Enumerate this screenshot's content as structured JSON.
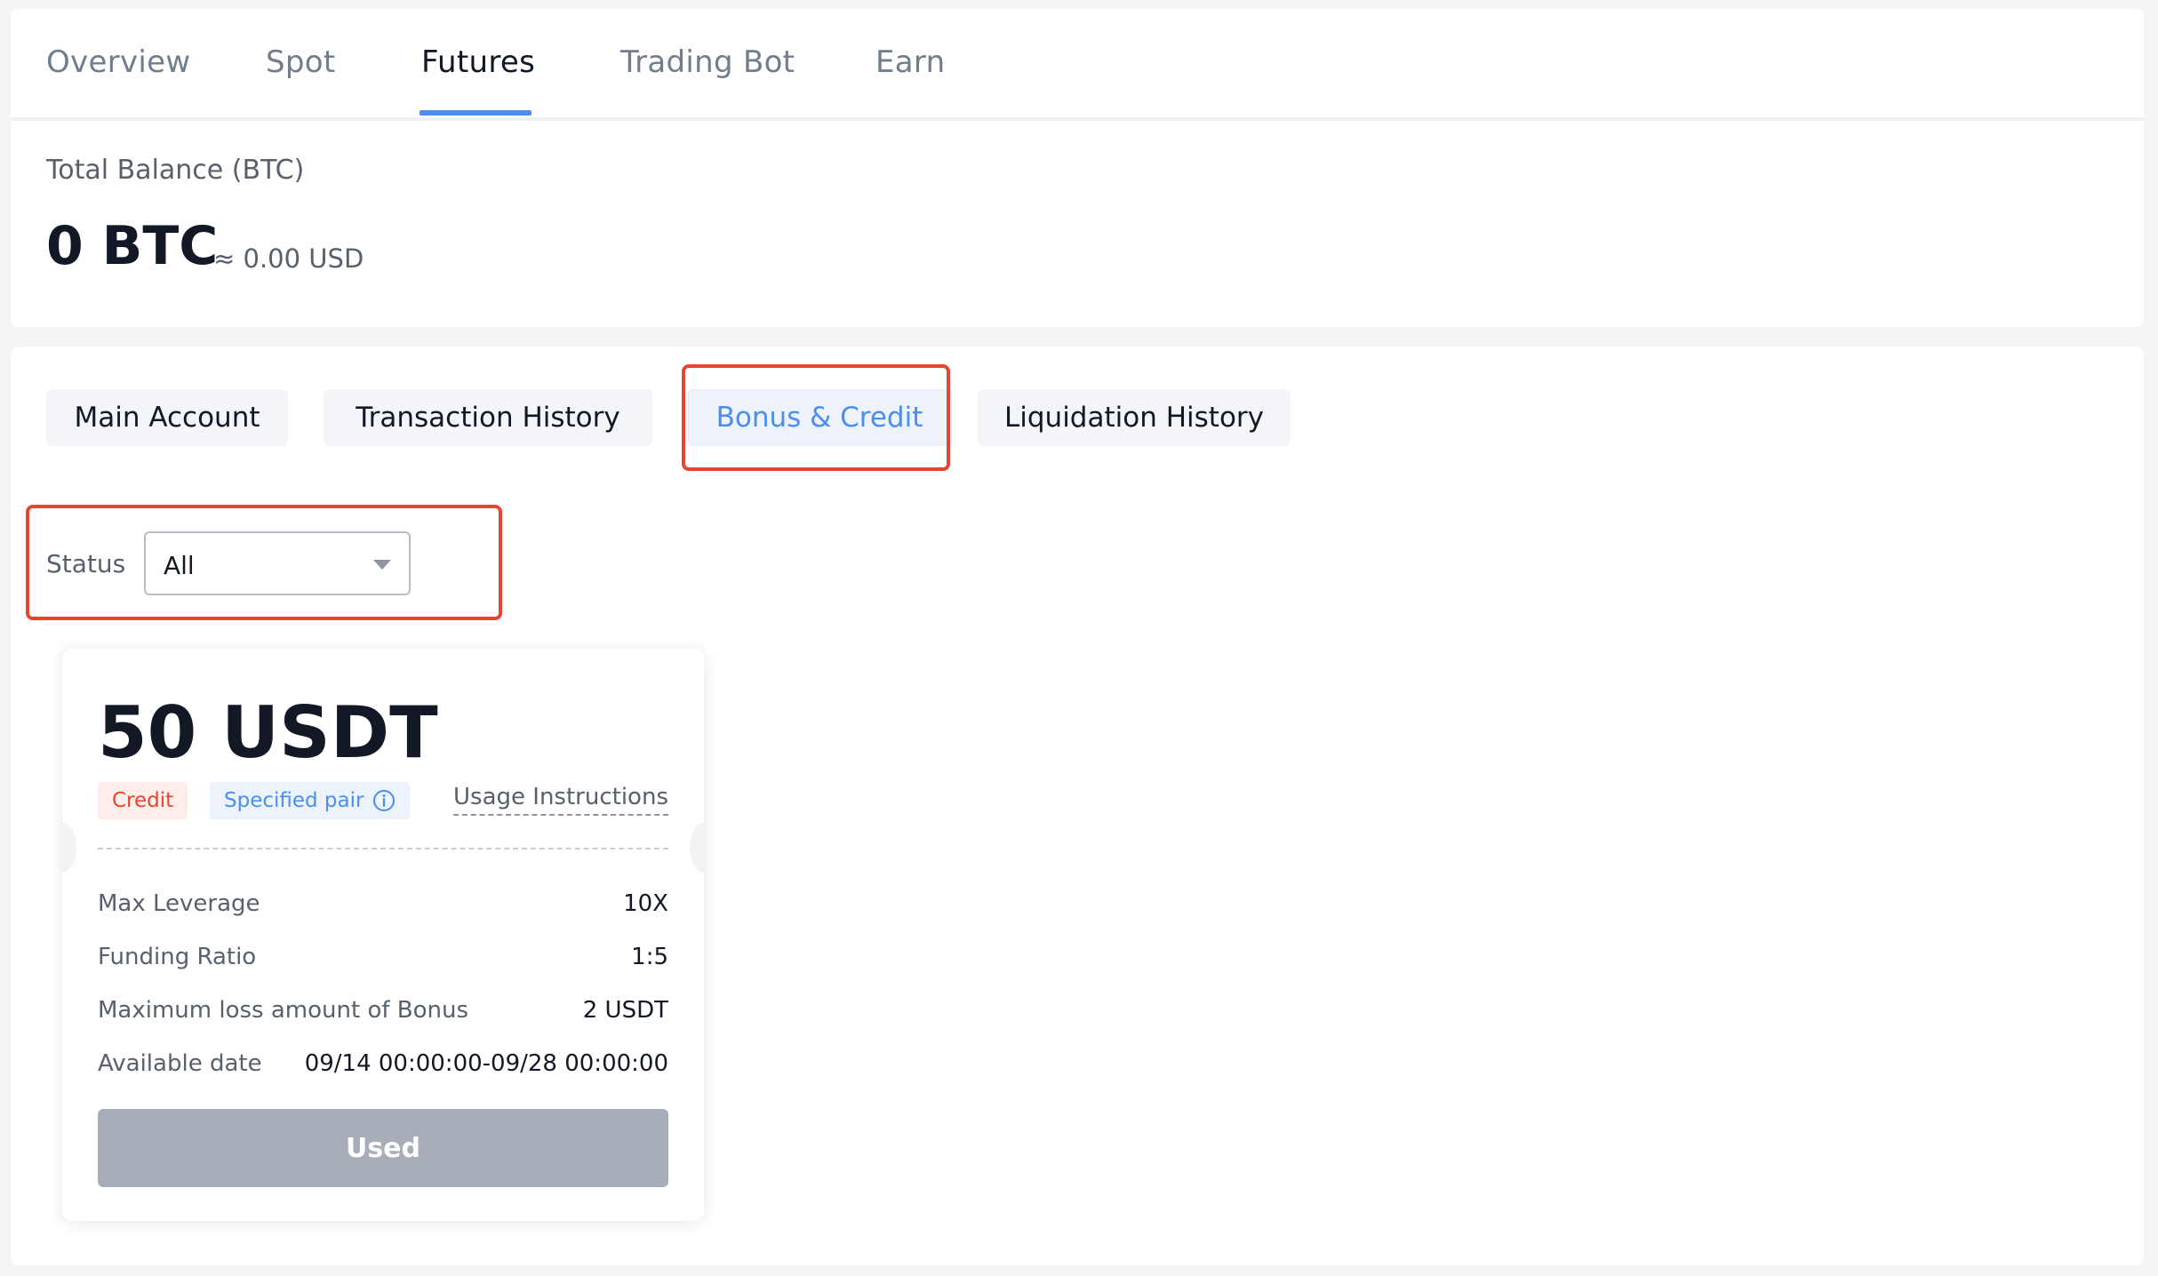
{
  "nav": {
    "tabs": [
      "Overview",
      "Spot",
      "Futures",
      "Trading Bot",
      "Earn"
    ],
    "active_tab": "Futures"
  },
  "balance": {
    "label": "Total Balance (BTC)",
    "value": "0 BTC",
    "approx": "≈ 0.00 USD"
  },
  "subtabs": {
    "items": [
      "Main Account",
      "Transaction History",
      "Bonus & Credit",
      "Liquidation History"
    ],
    "active": "Bonus & Credit"
  },
  "filter": {
    "status_label": "Status",
    "status_value": "All"
  },
  "card": {
    "amount": "50 USDT",
    "tag_credit": "Credit",
    "tag_pair": "Specified pair",
    "usage_link": "Usage Instructions",
    "details": [
      {
        "label": "Max Leverage",
        "value": "10X"
      },
      {
        "label": "Funding Ratio",
        "value": "1:5"
      },
      {
        "label": "Maximum loss amount of Bonus",
        "value": "2 USDT"
      },
      {
        "label": "Available date",
        "value": "09/14 00:00:00-09/28 00:00:00"
      }
    ],
    "button": "Used"
  },
  "colors": {
    "accent": "#4a8ef0",
    "highlight": "#e8442f",
    "credit_tag_bg": "#fdeee9",
    "pair_tag_bg": "#edf3fb",
    "used_button": "#a8aeb7"
  },
  "icons": {
    "specified_pair": "info-icon",
    "status_dropdown": "caret-down-icon"
  }
}
